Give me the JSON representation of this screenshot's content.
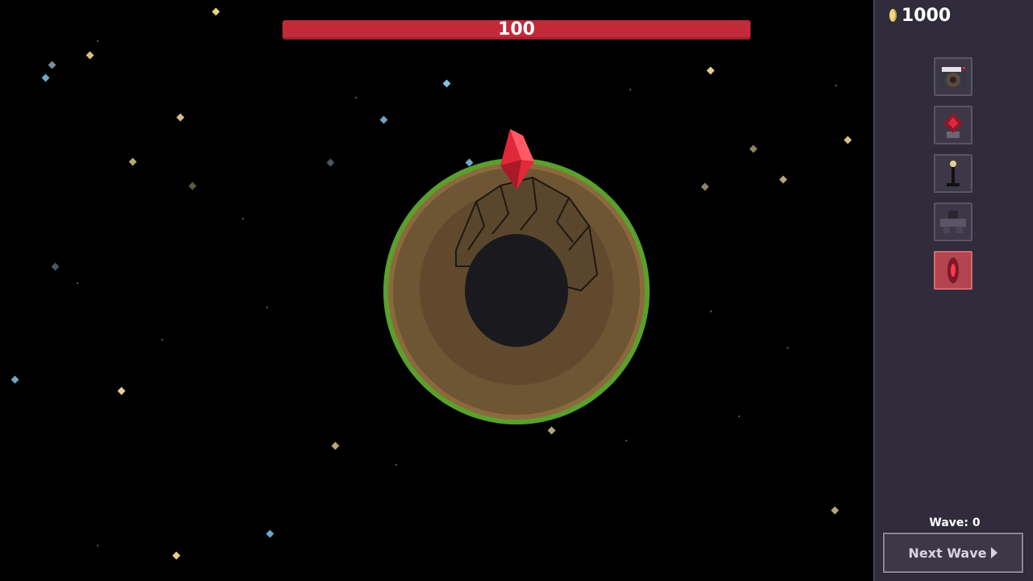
{
  "health": {
    "value": "100",
    "color": "#c22a3a"
  },
  "currency": {
    "icon": "gem-coin-icon",
    "amount": "1000"
  },
  "towers": [
    {
      "name": "cannon-tower-icon",
      "selected": false
    },
    {
      "name": "crystal-tower-icon",
      "selected": false
    },
    {
      "name": "lamp-tower-icon",
      "selected": false
    },
    {
      "name": "bunker-tower-icon",
      "selected": false
    },
    {
      "name": "red-crystal-tower-icon",
      "selected": true
    }
  ],
  "wave": {
    "label": "Wave: 0"
  },
  "next_wave": {
    "label": "Next Wave",
    "icon": "play-arrow-icon"
  },
  "colors": {
    "sidebar": "#302c3b",
    "planet_rim": "#5aa02c",
    "planet_ground": "#6e5534",
    "crystal": "#e0283a",
    "star_yellow": "#e8d08a",
    "star_blue": "#6fa6c8"
  }
}
